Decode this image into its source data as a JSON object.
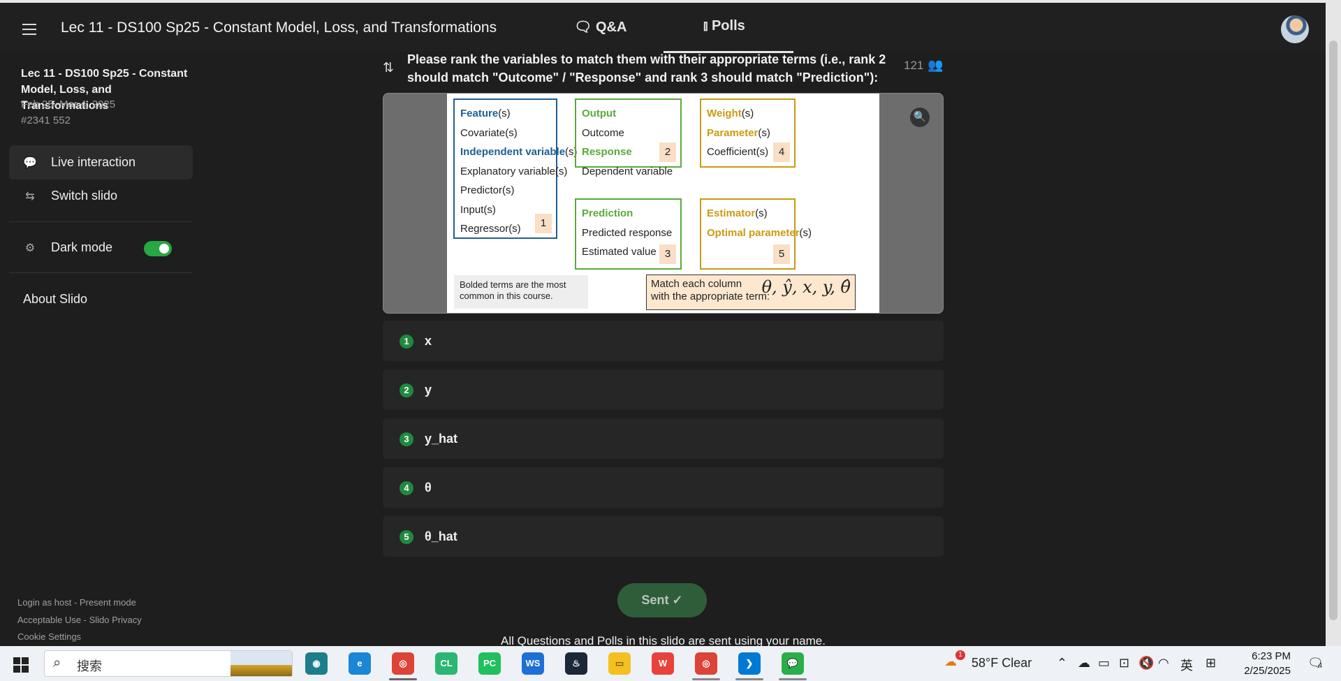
{
  "header": {
    "title": "Lec 11 - DS100 Sp25 - Constant Model, Loss, and Transformations",
    "tabs": [
      {
        "label": "Q&A",
        "icon": "chat-icon"
      },
      {
        "label": "Polls",
        "icon": "bar-chart-icon"
      }
    ]
  },
  "sidebar": {
    "event_title": "Lec 11 - DS100 Sp25 - Constant Model, Loss, and Transformations",
    "dates": "Feb 25–Mar 4, 2025",
    "code": "#2341 552",
    "items": [
      {
        "label": "Live interaction",
        "icon": "chat-bubbles-icon"
      },
      {
        "label": "Switch slido",
        "icon": "swap-icon"
      }
    ],
    "dark_mode_label": "Dark mode",
    "dark_mode_on": true,
    "about": "About Slido",
    "footer": [
      "Login as host - Present mode",
      "Acceptable Use - Slido Privacy",
      "Cookie Settings"
    ]
  },
  "poll": {
    "question": "Please rank the variables to match them with their appropriate terms (i.e., rank 2 should match \"Outcome\" / \"Response\" and rank 3 should match \"Prediction\"):",
    "participants": "121",
    "options": [
      {
        "rank": "1",
        "label": "x"
      },
      {
        "rank": "2",
        "label": "y"
      },
      {
        "rank": "3",
        "label": "y_hat"
      },
      {
        "rank": "4",
        "label": "θ"
      },
      {
        "rank": "5",
        "label": "θ_hat"
      }
    ],
    "sent_label": "Sent ✓",
    "notice": "All Questions and Polls in this slido are sent using your name."
  },
  "slide": {
    "box1": {
      "lines": [
        [
          "Feature",
          "(s)"
        ],
        [
          "",
          "Covariate(s)"
        ],
        [
          "Independent variable",
          "(s)"
        ],
        [
          "",
          "Explanatory variable(s)"
        ],
        [
          "",
          "Predictor(s)"
        ],
        [
          "",
          "Input(s)"
        ],
        [
          "",
          "Regressor(s)"
        ]
      ],
      "num": "1"
    },
    "box2": {
      "lines": [
        [
          "Output",
          ""
        ],
        [
          "",
          "Outcome"
        ],
        [
          "Response",
          ""
        ],
        [
          "",
          "Dependent variable"
        ]
      ],
      "num": "2"
    },
    "box3": {
      "lines": [
        [
          "Prediction",
          ""
        ],
        [
          "",
          "Predicted response"
        ],
        [
          "",
          "Estimated value"
        ]
      ],
      "num": "3"
    },
    "box4": {
      "lines": [
        [
          "Weight",
          "(s)"
        ],
        [
          "Parameter",
          "(s)"
        ],
        [
          "",
          "Coefficient(s)"
        ]
      ],
      "num": "4"
    },
    "box5": {
      "lines": [
        [
          "Estimator",
          "(s)"
        ],
        [
          "Optimal parameter",
          "(s)"
        ]
      ],
      "num": "5"
    },
    "note_bold": "Bolded terms are the most common in this course.",
    "note_match_1": "Match each column",
    "note_match_2": "with the appropriate term:",
    "math": "θ, ŷ, x, y, θ̂"
  },
  "taskbar": {
    "search_text": "搜索",
    "weather": "58°F  Clear",
    "weather_badge": "1",
    "ime": "英",
    "time": "6:23 PM",
    "date": "2/25/2025",
    "notifications": "4",
    "apps": [
      "memory-icon",
      "edge-icon",
      "chrome-icon",
      "clion-icon",
      "pycharm-icon",
      "webstorm-icon",
      "steam-icon",
      "file-explorer-icon",
      "wps-icon",
      "chrome-alt-icon",
      "vscode-icon",
      "wechat-icon"
    ]
  },
  "colors": {
    "accent_green": "#1f8a3e",
    "toggle": "#28a745",
    "feature_blue": "#1f5e94",
    "output_green": "#5aaa3c",
    "param_gold": "#c99b12"
  }
}
